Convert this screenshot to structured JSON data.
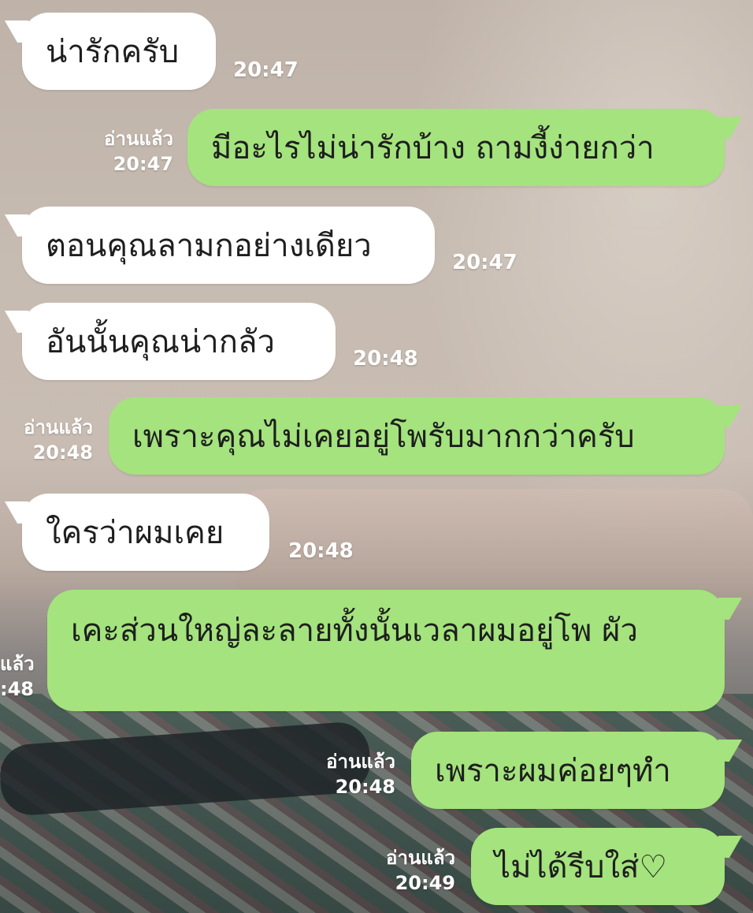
{
  "messages": [
    {
      "text": "น่ารักครับ",
      "time": "20:47"
    },
    {
      "text": "มีอะไรไม่น่ารักบ้าง ถามงี้ง่ายกว่า",
      "read": "อ่านแล้ว",
      "time": "20:47"
    },
    {
      "text": "ตอนคุณลามกอย่างเดียว",
      "time": "20:47"
    },
    {
      "text": "อันนั้นคุณน่ากลัว",
      "time": "20:48"
    },
    {
      "text": "เพราะคุณไม่เคยอยู่โพรับมากกว่าครับ",
      "read": "อ่านแล้ว",
      "time": "20:48"
    },
    {
      "text": "ใครว่าผมเคย",
      "time": "20:48"
    },
    {
      "text": "เคะส่วนใหญ่ละลายทั้งนั้นเวลาผมอยู่โพ ผัว",
      "read": "แล้ว",
      "time": ":48"
    },
    {
      "text": "เพราะผมค่อยๆทำ",
      "read": "อ่านแล้ว",
      "time": "20:48"
    },
    {
      "text": "ไม่ได้รีบใส่♡",
      "read": "อ่านแล้ว",
      "time": "20:49"
    }
  ]
}
